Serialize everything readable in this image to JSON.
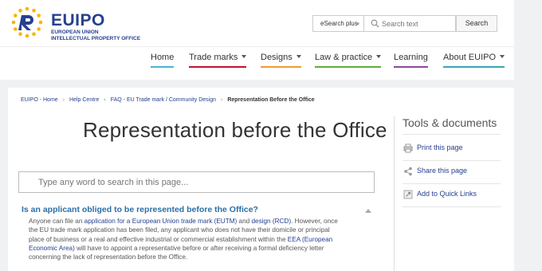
{
  "brand": {
    "name": "EUIPO",
    "sub_line1": "EUROPEAN UNION",
    "sub_line2": "INTELLECTUAL PROPERTY OFFICE"
  },
  "search": {
    "scope_label": "eSearch plus",
    "placeholder": "Search text",
    "button_label": "Search"
  },
  "nav": {
    "items": [
      {
        "label": "Home",
        "color": "#4bb3d8",
        "dropdown": false
      },
      {
        "label": "Trade marks",
        "color": "#c8102e",
        "dropdown": true
      },
      {
        "label": "Designs",
        "color": "#f29b30",
        "dropdown": true
      },
      {
        "label": "Law & practice",
        "color": "#5fad3b",
        "dropdown": true
      },
      {
        "label": "Learning",
        "color": "#8c4a9e",
        "dropdown": false
      },
      {
        "label": "About EUIPO",
        "color": "#3aa5b5",
        "dropdown": true
      }
    ]
  },
  "breadcrumb": {
    "items": [
      "EUIPO - Home",
      "Help Centre",
      "FAQ - EU Trade mark / Community Design"
    ],
    "current": "Representation Before the Office"
  },
  "page": {
    "title": "Representation before the Office",
    "search_placeholder": "Type any word to search in this page..."
  },
  "faq": {
    "question": "Is an applicant obliged to be represented before the Office?",
    "answer_parts": {
      "p1": "Anyone can file an ",
      "link1": "application for a European Union trade mark (EUTM)",
      "p2": " and ",
      "link2": "design (RCD)",
      "p3": ". However, once the EU trade mark application has been filed, any applicant who does not have their domicile or principal place of business or a real and effective industrial or commercial establishment within the ",
      "link3": "EEA (European Economic Area)",
      "p4": " will have to appoint a representative before or after receiving a formal deficiency letter concerning the lack of representation before the Office."
    }
  },
  "sidebar": {
    "title": "Tools & documents",
    "items": [
      {
        "label": "Print this page",
        "icon": "print-icon"
      },
      {
        "label": "Share this page",
        "icon": "share-icon"
      },
      {
        "label": "Add to Quick Links",
        "icon": "link-icon"
      }
    ]
  },
  "colors": {
    "brand_blue": "#25408f",
    "logo_yellow": "#f5b700",
    "question_blue": "#2a6fa8"
  }
}
